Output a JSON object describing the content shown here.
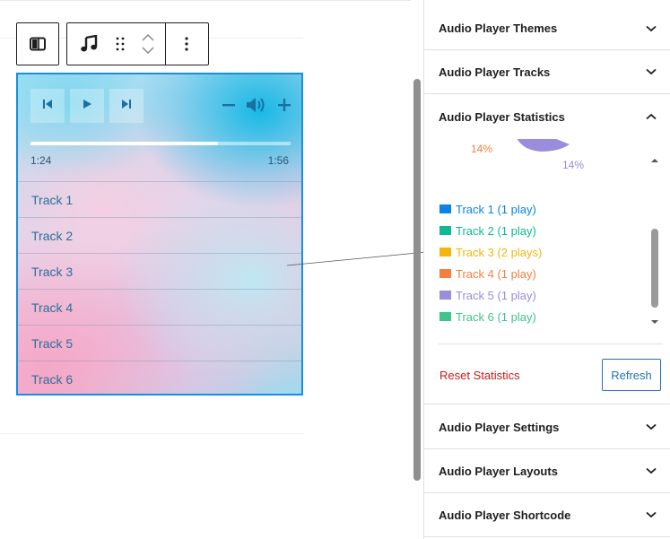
{
  "toolbar": {
    "block_type_icon": "columns-icon",
    "block_icon": "music-note-icon",
    "drag_icon": "drag-handle-icon",
    "move_up_icon": "chevron-up-icon",
    "move_down_icon": "chevron-down-icon",
    "options_icon": "vertical-ellipsis-icon"
  },
  "player": {
    "controls": [
      "previous-icon",
      "play-icon",
      "next-icon"
    ],
    "volume_controls": [
      "minus-icon",
      "speaker-icon",
      "plus-icon"
    ],
    "progress_fraction": 0.72,
    "current_time": "1:24",
    "duration": "1:56",
    "tracks": [
      "Track 1",
      "Track 2",
      "Track 3",
      "Track 4",
      "Track 5",
      "Track 6"
    ]
  },
  "sidebar": {
    "panels_top": [
      {
        "title": "Audio Player Themes",
        "expanded": false
      },
      {
        "title": "Audio Player Tracks",
        "expanded": false
      },
      {
        "title": "Audio Player Statistics",
        "expanded": true
      }
    ],
    "statistics": {
      "pie_labels": [
        {
          "text": "14%",
          "color": "#f5803e"
        },
        {
          "text": "14%",
          "color": "#9b8ddb"
        }
      ],
      "legend": [
        {
          "label": "Track 1 (1 play)",
          "color": "#0a84e6"
        },
        {
          "label": "Track 2 (1 play)",
          "color": "#0cba94"
        },
        {
          "label": "Track 3 (2 plays)",
          "color": "#f4b60c"
        },
        {
          "label": "Track 4 (1 play)",
          "color": "#f5803e"
        },
        {
          "label": "Track 5 (1 play)",
          "color": "#9b8ddb"
        },
        {
          "label": "Track 6 (1 play)",
          "color": "#3ec48d"
        }
      ],
      "reset_label": "Reset Statistics",
      "refresh_label": "Refresh"
    },
    "panels_bottom": [
      {
        "title": "Audio Player Settings",
        "expanded": false
      },
      {
        "title": "Audio Player Layouts",
        "expanded": false
      },
      {
        "title": "Audio Player Shortcode",
        "expanded": false
      }
    ]
  },
  "colors": {
    "accent": "#2271b1",
    "player_border": "#1b8fd6",
    "danger": "#cc1818"
  }
}
